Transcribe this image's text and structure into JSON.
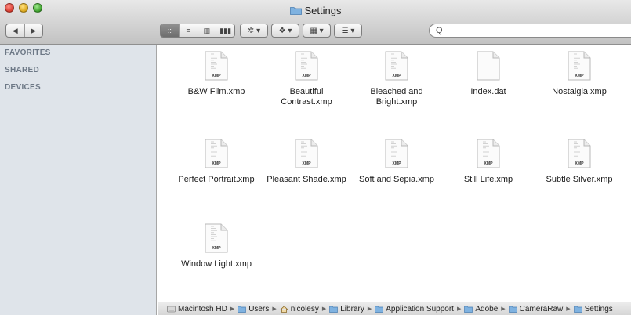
{
  "window": {
    "title": "Settings"
  },
  "toolbar": {
    "nav_back": "◀",
    "nav_forward": "▶",
    "view_icon": "::",
    "view_list": "≡",
    "view_column": "▥",
    "view_coverflow": "▮▮▮",
    "action_label": "✲ ▾",
    "dropbox_label": "❖ ▾",
    "arrange_label": "▦ ▾",
    "share_label": "☰ ▾",
    "search_placeholder": "Q"
  },
  "sidebar": {
    "sections": [
      "FAVORITES",
      "SHARED",
      "DEVICES"
    ]
  },
  "files": [
    {
      "name": "B&W Film.xmp",
      "badge": "XMP"
    },
    {
      "name": "Beautiful Contrast.xmp",
      "badge": "XMP"
    },
    {
      "name": "Bleached and Bright.xmp",
      "badge": "XMP"
    },
    {
      "name": "Index.dat",
      "badge": ""
    },
    {
      "name": "Nostalgia.xmp",
      "badge": "XMP"
    },
    {
      "name": "Perfect Portrait.xmp",
      "badge": "XMP"
    },
    {
      "name": "Pleasant Shade.xmp",
      "badge": "XMP"
    },
    {
      "name": "Soft and Sepia.xmp",
      "badge": "XMP"
    },
    {
      "name": "Still Life.xmp",
      "badge": "XMP"
    },
    {
      "name": "Subtle Silver.xmp",
      "badge": "XMP"
    },
    {
      "name": "Window Light.xmp",
      "badge": "XMP"
    }
  ],
  "pathbar": {
    "crumbs": [
      "Macintosh HD",
      "Users",
      "nicolesy",
      "Library",
      "Application Support",
      "Adobe",
      "CameraRaw",
      "Settings"
    ]
  },
  "colors": {
    "sidebar_bg": "#dfe4ea",
    "sidebar_heading": "#6d7886",
    "folder_blue": "#7fb2e0"
  }
}
